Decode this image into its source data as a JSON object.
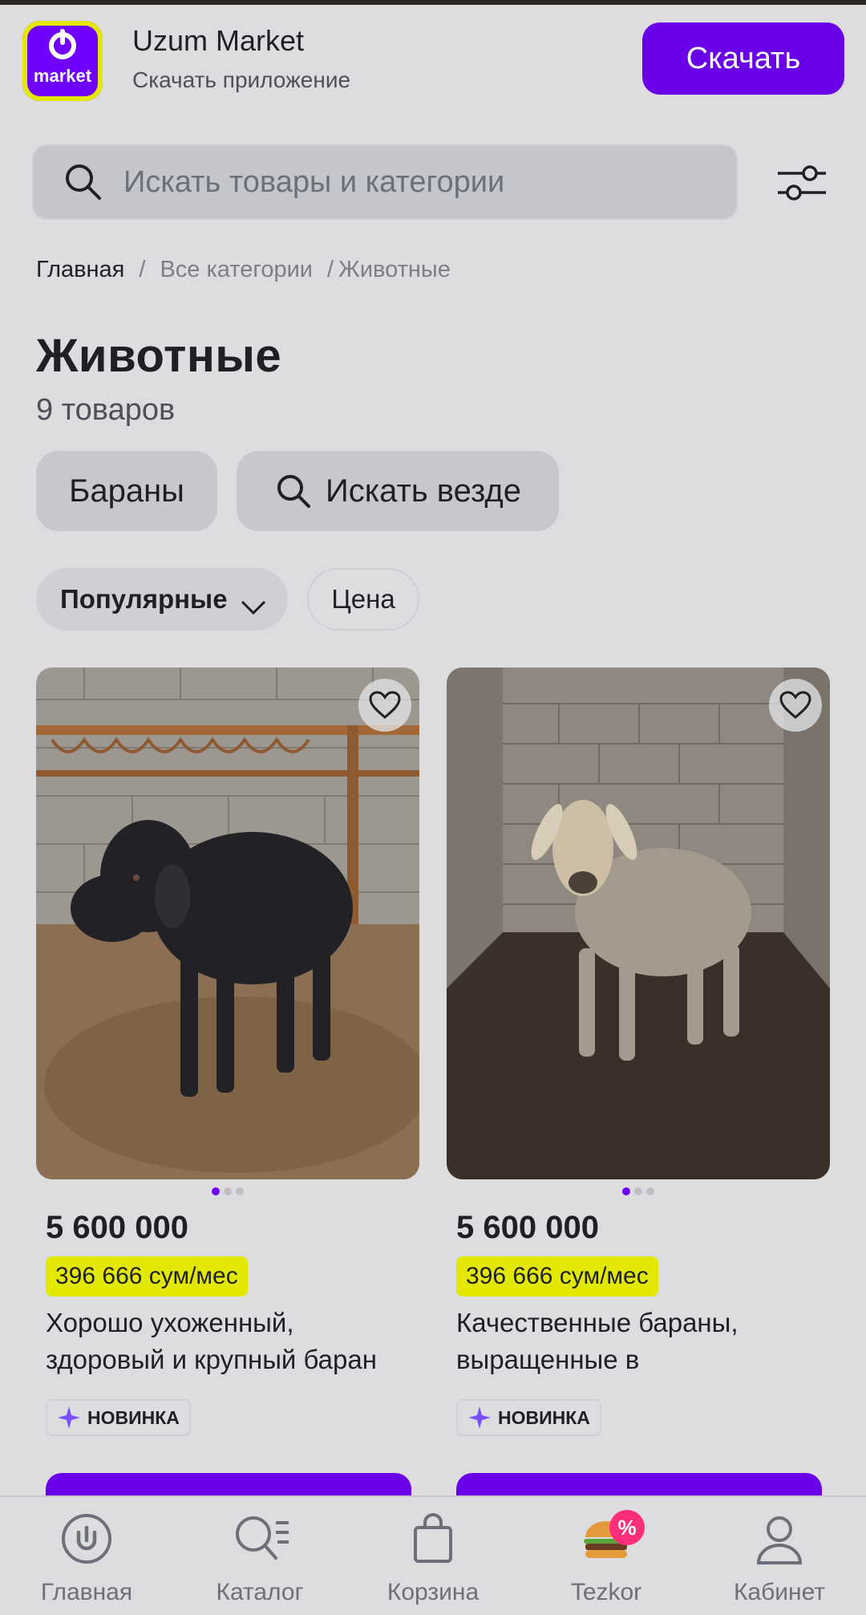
{
  "banner": {
    "logo_text": "market",
    "app_title": "Uzum Market",
    "app_subtitle": "Скачать приложение",
    "download_label": "Скачать"
  },
  "search": {
    "placeholder": "Искать товары и категории"
  },
  "breadcrumb": {
    "home": "Главная",
    "separator": "/",
    "all_categories": "Все категории",
    "current": "Животные"
  },
  "category": {
    "title": "Животные",
    "count": "9 товаров"
  },
  "chips": {
    "rams": "Бараны",
    "search_everywhere": "Искать везде"
  },
  "sort": {
    "popular": "Популярные",
    "price": "Цена"
  },
  "products": [
    {
      "price": "5 600 000",
      "monthly": "396 666 сум/мес",
      "name": "Хорошо ухоженный, здоровый и крупный баран",
      "badge": "НОВИНКА",
      "image_slides": 3,
      "active_slide": 1
    },
    {
      "price": "5 600 000",
      "monthly": "396 666 сум/мес",
      "name": "Качественные бараны, выращенные в",
      "badge": "НОВИНКА",
      "image_slides": 3,
      "active_slide": 1
    }
  ],
  "nav": {
    "home": "Главная",
    "catalog": "Каталог",
    "cart": "Корзина",
    "tezkor": "Tezkor",
    "tezkor_badge": "%",
    "cabinet": "Кабинет"
  },
  "colors": {
    "brand": "#6a00e8",
    "installment_badge": "#e3e800",
    "background": "#dddde0",
    "promo_badge": "#ff2e7a"
  }
}
